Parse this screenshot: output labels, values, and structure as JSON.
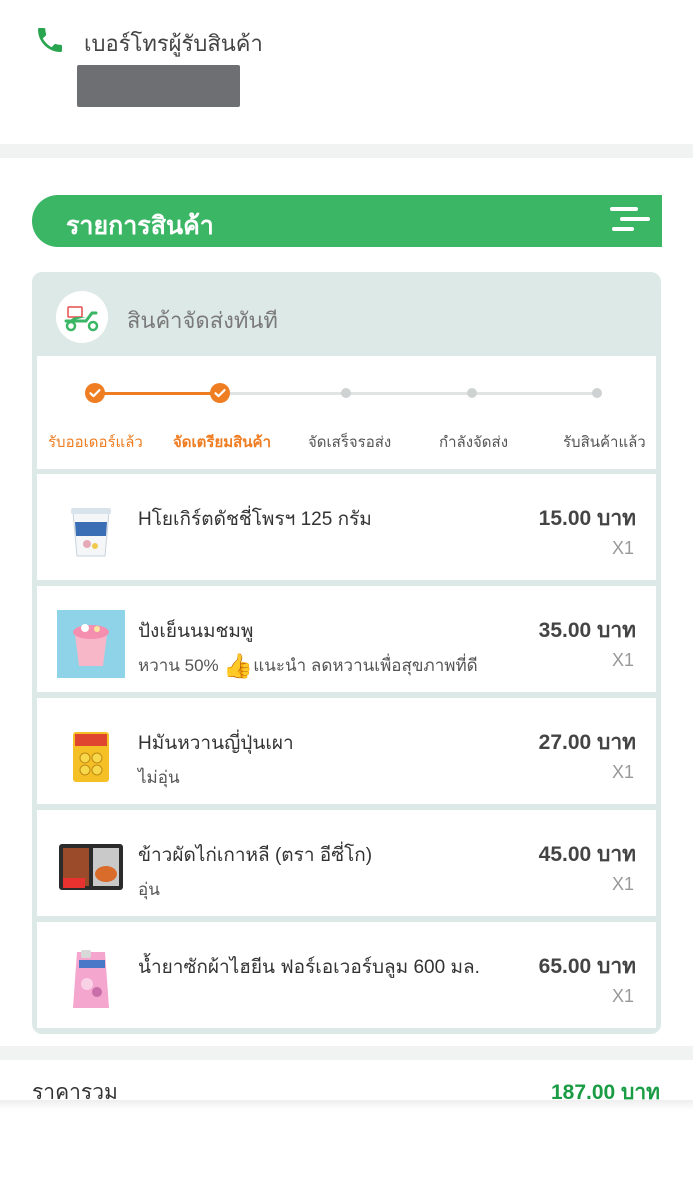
{
  "contact": {
    "label": "เบอร์โทรผู้รับสินค้า",
    "icon": "phone-icon",
    "phone_color": "#2aa54f"
  },
  "section": {
    "title": "รายการสินค้า",
    "accent": "#3ab665"
  },
  "delivery": {
    "label": "สินค้าจัดส่งทันที",
    "icon": "scooter-icon",
    "progress_color": "#ef7d22",
    "steps": [
      {
        "label": "รับออเดอร์แล้ว",
        "state": "done"
      },
      {
        "label": "จัดเตรียมสินค้า",
        "state": "current"
      },
      {
        "label": "จัดเสร็จรอส่ง",
        "state": "pending"
      },
      {
        "label": "กำลังจัดส่ง",
        "state": "pending"
      },
      {
        "label": "รับสินค้าแล้ว",
        "state": "pending"
      }
    ]
  },
  "items": [
    {
      "name": "Hโยเกิร์ตดัชชี่โพรฯ 125 กรัม",
      "note": "",
      "price": "15.00 บาท",
      "qty": "X1",
      "icon": "yogurt-cup-icon"
    },
    {
      "name": "ปังเย็นนมชมพู",
      "note": "หวาน 50%",
      "note_after_icon": "แนะนำ ลดหวานเพื่อสุขภาพที่ดี",
      "price": "35.00 บาท",
      "qty": "X1",
      "icon": "pink-dessert-icon"
    },
    {
      "name": "Hมันหวานญี่ปุ่นเผา",
      "note": "ไม่อุ่น",
      "price": "27.00 บาท",
      "qty": "X1",
      "icon": "sweet-potato-pack-icon"
    },
    {
      "name": "ข้าวผัดไก่เกาหลี (ตรา อีซี่โก)",
      "note": "อุ่น",
      "price": "45.00 บาท",
      "qty": "X1",
      "icon": "fried-rice-box-icon"
    },
    {
      "name": "น้ำยาซักผ้าไฮยีน ฟอร์เอเวอร์บลูม 600 มล.",
      "note": "",
      "price": "65.00 บาท",
      "qty": "X1",
      "icon": "detergent-pouch-icon"
    }
  ],
  "summary": {
    "total_label": "ราคารวม",
    "total_value": "187.00 บาท",
    "total_color": "#1a9c45"
  }
}
